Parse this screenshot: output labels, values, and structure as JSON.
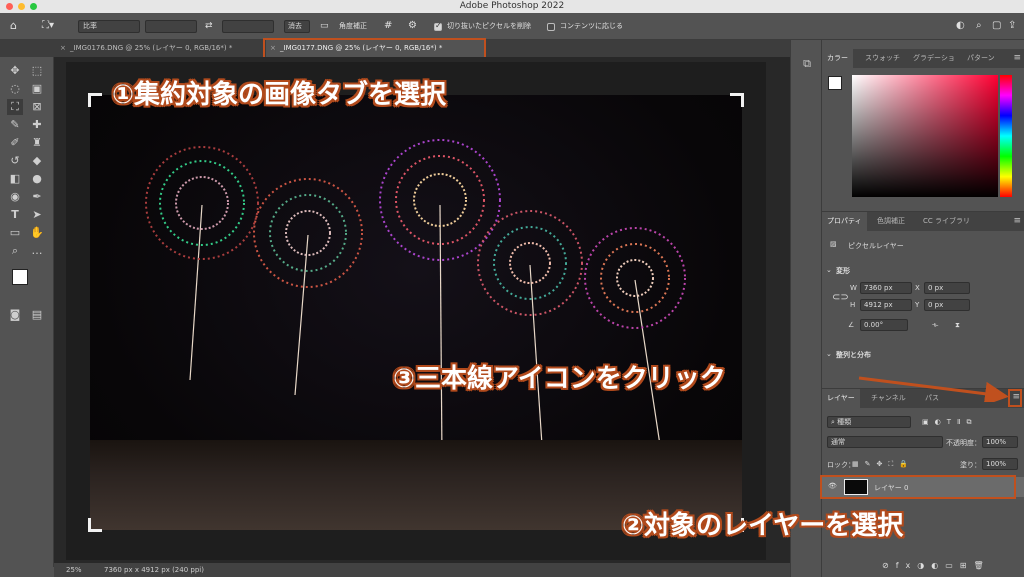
{
  "window": {
    "title": "Adobe Photoshop 2022"
  },
  "options_bar": {
    "ratio_label": "比率",
    "clear_label": "消去",
    "straighten_label": "角度補正",
    "delete_cropped_label": "切り抜いたピクセルを削除",
    "delete_cropped_checked": true,
    "content_aware_label": "コンテンツに応じる",
    "content_aware_checked": false
  },
  "tabs": [
    {
      "label": "_IMG0176.DNG @ 25% (レイヤー 0, RGB/16*) *",
      "active": false
    },
    {
      "label": "_IMG0177.DNG @ 25% (レイヤー 0, RGB/16*) *",
      "active": true
    }
  ],
  "status_bar": {
    "zoom": "25%",
    "info": "7360 px x 4912 px (240 ppi)"
  },
  "color_panel": {
    "tabs": [
      "カラー",
      "スウォッチ",
      "グラデーショ",
      "パターン"
    ],
    "hue_color": "#ff0033"
  },
  "properties_panel": {
    "tabs": [
      "プロパティ",
      "色調補正",
      "CC ライブラリ"
    ],
    "layer_kind": "ピクセルレイヤー",
    "transform_heading": "変形",
    "w_label": "W",
    "w_value": "7360 px",
    "h_label": "H",
    "h_value": "4912 px",
    "x_label": "X",
    "x_value": "0 px",
    "y_label": "Y",
    "y_value": "0 px",
    "angle_value": "0.00°",
    "align_heading": "整列と分布"
  },
  "layers_panel": {
    "tabs": [
      "レイヤー",
      "チャンネル",
      "パス"
    ],
    "filter_kind": "種類",
    "blend_mode": "通常",
    "opacity_label": "不透明度：",
    "opacity_value": "100%",
    "lock_label": "ロック：",
    "fill_label": "塗り：",
    "fill_value": "100%",
    "layer_name": "レイヤー 0"
  },
  "annotations": {
    "step1": "①集約対象の画像タブを選択",
    "step2": "②対象のレイヤーを選択",
    "step3": "③三本線アイコンをクリック",
    "color": "#c0501e"
  }
}
